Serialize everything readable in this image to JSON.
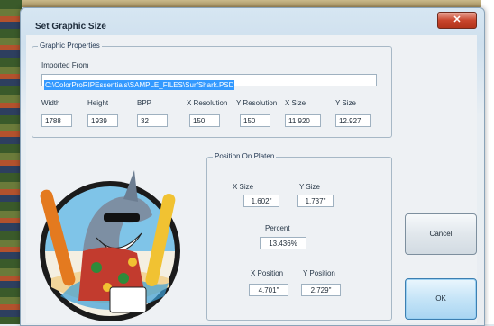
{
  "dialog": {
    "title": "Set Graphic Size",
    "close_label": "✕"
  },
  "graphic_properties": {
    "group_label": "Graphic Properties",
    "imported_from_label": "Imported From",
    "path": "C:\\ColorProRIPEssentials\\SAMPLE_FILES\\SurfShark.PSD",
    "columns": [
      {
        "label": "Width",
        "value": "1788"
      },
      {
        "label": "Height",
        "value": "1939"
      },
      {
        "label": "BPP",
        "value": "32"
      },
      {
        "label": "X Resolution",
        "value": "150"
      },
      {
        "label": "Y Resolution",
        "value": "150"
      },
      {
        "label": "X Size",
        "value": "11.920"
      },
      {
        "label": "Y Size",
        "value": "12.927"
      }
    ]
  },
  "position_on_platen": {
    "group_label": "Position On Platen",
    "x_size_label": "X Size",
    "x_size_value": "1.602\"",
    "y_size_label": "Y Size",
    "y_size_value": "1.737\"",
    "percent_label": "Percent",
    "percent_value": "13.436%",
    "x_position_label": "X Position",
    "x_position_value": "4.701\"",
    "y_position_label": "Y Position",
    "y_position_value": "2.729\""
  },
  "buttons": {
    "cancel": "Cancel",
    "ok": "OK"
  },
  "colors": {
    "selection": "#3399ff",
    "close_button": "#c8452c",
    "default_button": "#c5e4f7"
  }
}
